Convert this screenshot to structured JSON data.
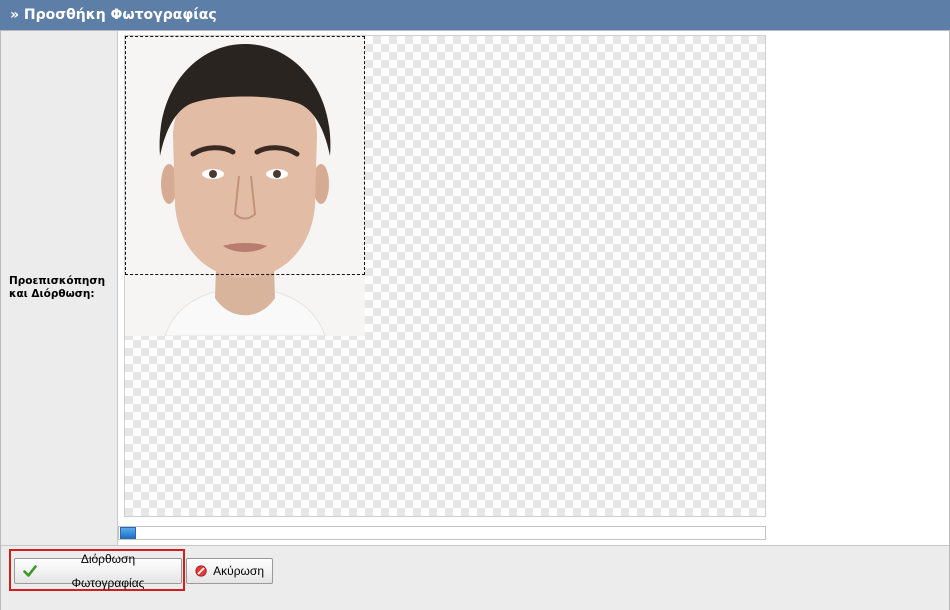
{
  "panel": {
    "title": "» Προσθήκη Φωτογραφίας"
  },
  "form": {
    "preview_label": "Προεπισκόπηση\nκαι Διόρθωση:"
  },
  "editor": {
    "image": "portrait-photo",
    "crop_box": true,
    "zoom_slider": {
      "value": 0.0
    }
  },
  "actions": {
    "save_label": "Διόρθωση Φωτογραφίας",
    "cancel_label": "Ακύρωση"
  },
  "colors": {
    "header": "#5d7ea6",
    "highlight": "#d11f1f",
    "panel_bg": "#ececec"
  },
  "icons": {
    "save": "check-icon",
    "cancel": "cancel-icon"
  }
}
